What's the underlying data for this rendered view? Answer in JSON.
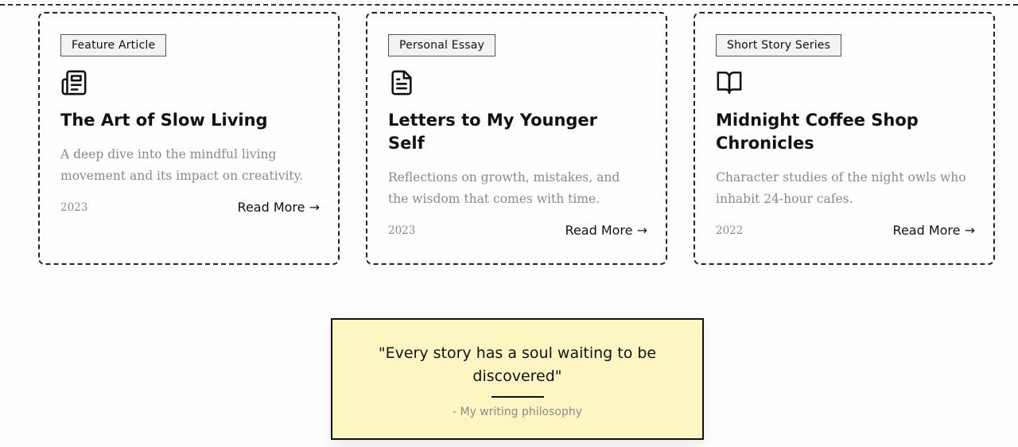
{
  "cards": [
    {
      "tag": "Feature Article",
      "icon": "newspaper-icon",
      "title": "The Art of Slow Living",
      "description": "A deep dive into the mindful living movement and its impact on creativity.",
      "year": "2023",
      "link": "Read More →"
    },
    {
      "tag": "Personal Essay",
      "icon": "document-icon",
      "title": "Letters to My Younger Self",
      "description": "Reflections on growth, mistakes, and the wisdom that comes with time.",
      "year": "2023",
      "link": "Read More →"
    },
    {
      "tag": "Short Story Series",
      "icon": "open-book-icon",
      "title": "Midnight Coffee Shop Chronicles",
      "description": "Character studies of the night owls who inhabit 24-hour cafes.",
      "year": "2022",
      "link": "Read More →"
    }
  ],
  "quote": {
    "text": "\"Every story has a soul waiting to be discovered\"",
    "source": "- My writing philosophy"
  },
  "colors": {
    "quote_background": "#fef6c2",
    "muted_text": "#8a8a8a",
    "border": "#222222"
  }
}
